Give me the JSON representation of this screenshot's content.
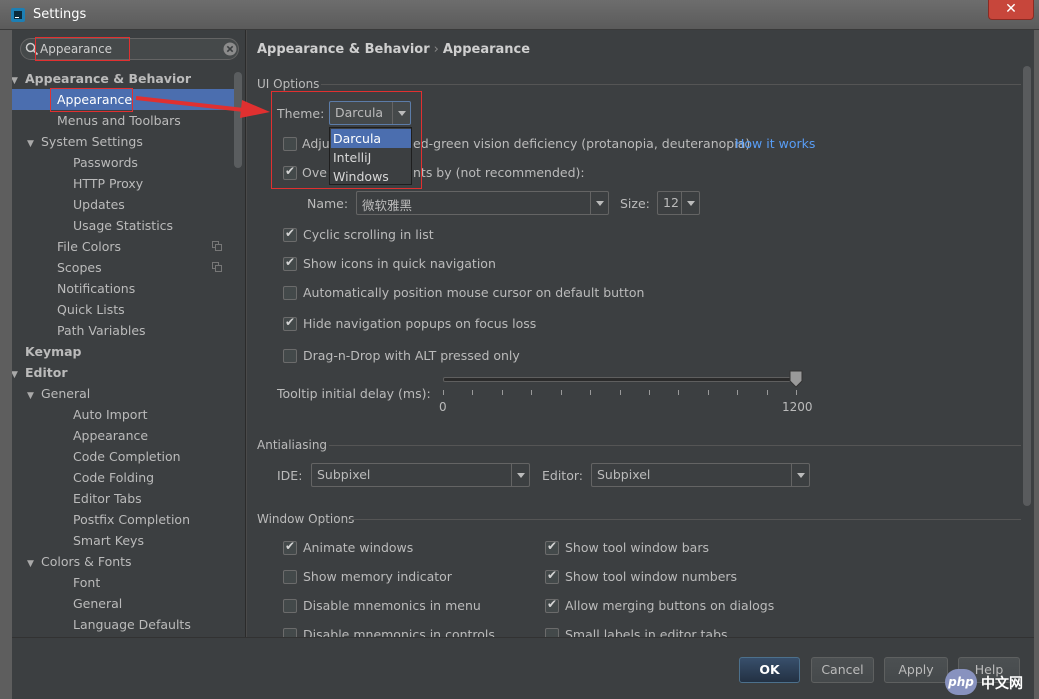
{
  "window": {
    "title": "Settings",
    "close": "✕"
  },
  "search": {
    "value": "Appearance"
  },
  "tree": [
    {
      "label": "Appearance & Behavior",
      "arrow": "▼",
      "bold": true
    },
    {
      "label": "Appearance",
      "selected": true
    },
    {
      "label": "Menus and Toolbars"
    },
    {
      "label": "System Settings",
      "arrow": "▼"
    },
    {
      "label": "Passwords"
    },
    {
      "label": "HTTP Proxy"
    },
    {
      "label": "Updates"
    },
    {
      "label": "Usage Statistics"
    },
    {
      "label": "File Colors",
      "copy_icon": true
    },
    {
      "label": "Scopes",
      "copy_icon": true
    },
    {
      "label": "Notifications"
    },
    {
      "label": "Quick Lists"
    },
    {
      "label": "Path Variables"
    },
    {
      "label": "Keymap",
      "bold": true
    },
    {
      "label": "Editor",
      "arrow": "▼",
      "bold": true
    },
    {
      "label": "General",
      "arrow": "▼"
    },
    {
      "label": "Auto Import"
    },
    {
      "label": "Appearance"
    },
    {
      "label": "Code Completion"
    },
    {
      "label": "Code Folding"
    },
    {
      "label": "Editor Tabs"
    },
    {
      "label": "Postfix Completion"
    },
    {
      "label": "Smart Keys"
    },
    {
      "label": "Colors & Fonts",
      "arrow": "▼"
    },
    {
      "label": "Font"
    },
    {
      "label": "General"
    },
    {
      "label": "Language Defaults"
    }
  ],
  "breadcrumb": {
    "part1": "Appearance & Behavior",
    "sep": "›",
    "part2": "Appearance"
  },
  "ui_options": {
    "title": "UI Options",
    "theme_label": "Theme:",
    "theme_value": "Darcula",
    "theme_options": [
      "Darcula",
      "IntelliJ",
      "Windows"
    ],
    "adjust_prefix": "Adju",
    "adjust_suffix": "ed-green vision deficiency (protanopia, deuteranopia)",
    "adjust_checked": false,
    "how_it_works": "How it works",
    "override_prefix": "Ove",
    "override_suffix": "nts by (not recommended):",
    "override_checked": true,
    "name_label": "Name:",
    "name_value": "微软雅黑",
    "size_label": "Size:",
    "size_value": "12",
    "options": [
      {
        "label": "Cyclic scrolling in list",
        "checked": true
      },
      {
        "label": "Show icons in quick navigation",
        "checked": true
      },
      {
        "label": "Automatically position mouse cursor on default button",
        "checked": false
      },
      {
        "label": "Hide navigation popups on focus loss",
        "checked": true
      },
      {
        "label": "Drag-n-Drop with ALT pressed only",
        "checked": false
      }
    ],
    "tooltip_label": "Tooltip initial delay (ms):",
    "tooltip_value": 1200,
    "tooltip_min": "0",
    "tooltip_max": "1200"
  },
  "antialiasing": {
    "title": "Antialiasing",
    "ide_label": "IDE:",
    "ide_value": "Subpixel",
    "editor_label": "Editor:",
    "editor_value": "Subpixel"
  },
  "window_options": {
    "title": "Window Options",
    "left": [
      {
        "label": "Animate windows",
        "checked": true
      },
      {
        "label": "Show memory indicator",
        "checked": false
      },
      {
        "label": "Disable mnemonics in menu",
        "checked": false
      },
      {
        "label": "Disable mnemonics in controls",
        "checked": false
      }
    ],
    "right": [
      {
        "label": "Show tool window bars",
        "checked": true
      },
      {
        "label": "Show tool window numbers",
        "checked": true
      },
      {
        "label": "Allow merging buttons on dialogs",
        "checked": true
      },
      {
        "label": "Small labels in editor tabs",
        "checked": false
      }
    ]
  },
  "buttons": {
    "ok": "OK",
    "cancel": "Cancel",
    "apply": "Apply",
    "help": "Help"
  },
  "watermark": {
    "php": "php",
    "cn": "中文网"
  },
  "colors": {
    "selection": "#4b6eaf",
    "link": "#589df6",
    "annotation": "#e03030"
  }
}
